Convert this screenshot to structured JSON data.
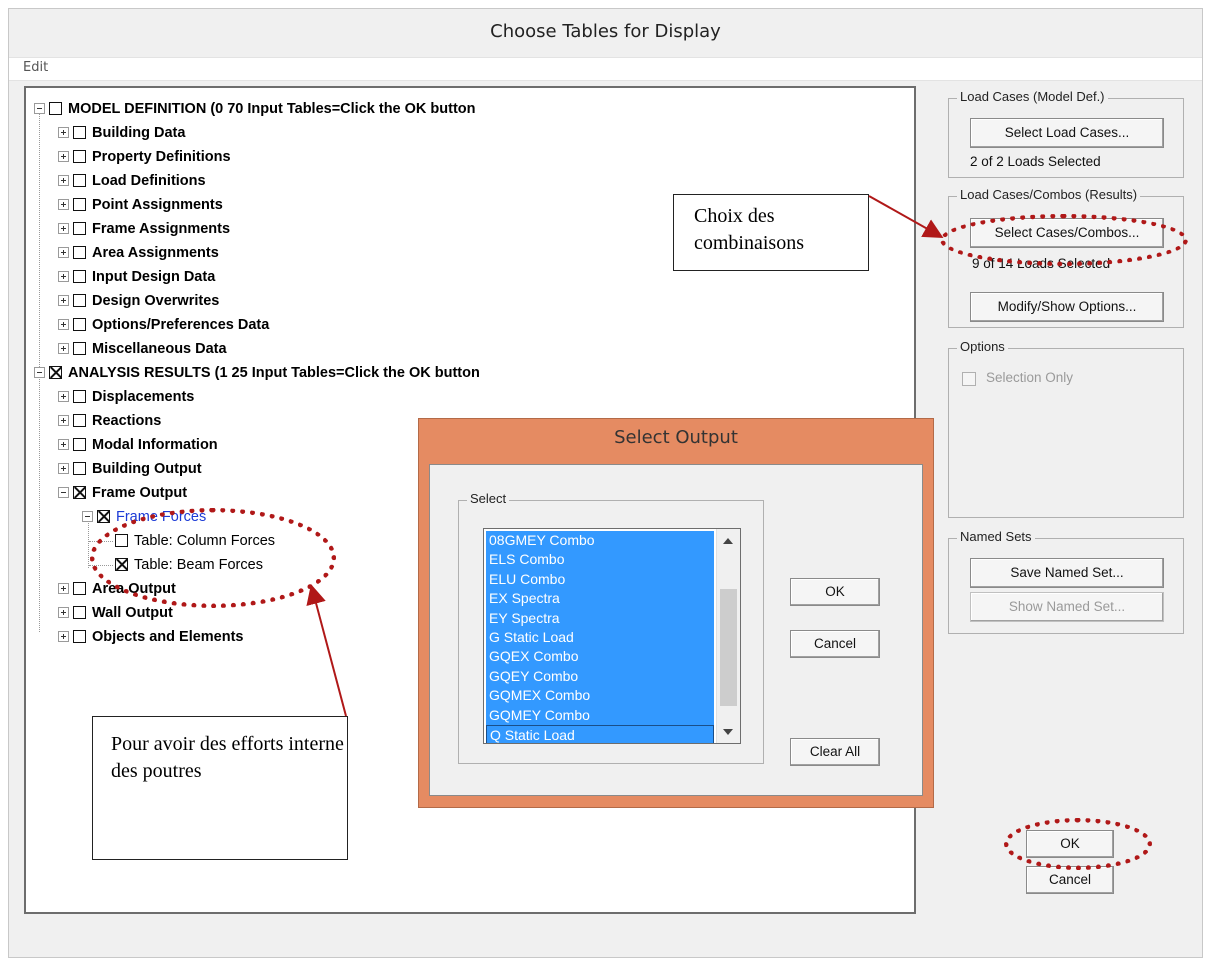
{
  "window": {
    "title": "Choose Tables for Display"
  },
  "menu": {
    "edit": "Edit"
  },
  "tree": {
    "model_root": "MODEL DEFINITION  (0  70 Input Tables=Click the OK button",
    "model_children": [
      "Building Data",
      "Property Definitions",
      "Load Definitions",
      "Point Assignments",
      "Frame Assignments",
      "Area Assignments",
      "Input Design Data",
      "Design Overwrites",
      "Options/Preferences Data",
      "Miscellaneous Data"
    ],
    "analysis_root": "ANALYSIS RESULTS  (1  25 Input Tables=Click the OK button",
    "analysis_children_a": [
      "Displacements",
      "Reactions",
      "Modal Information",
      "Building Output"
    ],
    "frame_output": "Frame Output",
    "frame_forces": "Frame Forces",
    "column_forces": "Table:  Column Forces",
    "beam_forces": "Table:  Beam Forces",
    "analysis_children_b": [
      "Area Output",
      "Wall Output",
      "Objects and Elements"
    ]
  },
  "load_cases": {
    "legend": "Load Cases (Model Def.)",
    "button": "Select Load Cases...",
    "status": "2  of  2  Loads Selected"
  },
  "combos": {
    "legend": "Load Cases/Combos (Results)",
    "button": "Select Cases/Combos...",
    "status": "9  of  14  Loads Selected",
    "options_button": "Modify/Show Options..."
  },
  "options": {
    "legend": "Options",
    "selection_only": "Selection Only"
  },
  "named_sets": {
    "legend": "Named Sets",
    "save": "Save Named Set...",
    "show": "Show Named Set..."
  },
  "main_buttons": {
    "ok": "OK",
    "cancel": "Cancel"
  },
  "select_output": {
    "title": "Select Output",
    "group": "Select",
    "items": [
      "08GMEY Combo",
      "ELS Combo",
      "ELU Combo",
      "EX Spectra",
      "EY Spectra",
      "G Static Load",
      "GQEX Combo",
      "GQEY Combo",
      "GQMEX Combo",
      "GQMEY Combo",
      "Q Static Load"
    ],
    "ok": "OK",
    "cancel": "Cancel",
    "clear_all": "Clear All"
  },
  "annotations": {
    "combos_note": "Choix des combinaisons",
    "beams_note": "Pour avoir des efforts interne des poutres"
  },
  "colors": {
    "dialog": "#e58b62",
    "selection": "#3399ff",
    "annotation": "#b01818"
  }
}
